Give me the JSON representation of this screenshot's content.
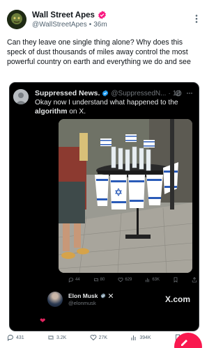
{
  "author": {
    "name": "Wall Street Apes",
    "handle": "@WallStreetApes",
    "separator": "•",
    "time": "36m"
  },
  "post": {
    "text": "Can they leave one single thing alone? Why does this speck of dust thousands of miles away control the most powerful country on earth and everything we do and see"
  },
  "quoted": {
    "name": "Suppressed News.",
    "handle": "@SuppressedN...",
    "separator": "·",
    "time": "1d",
    "text_plain_1": "Okay now I understand what happened to the ",
    "text_bold": "algorithm",
    "text_plain_2": " on X.",
    "metrics": {
      "replies": "44",
      "reposts": "80",
      "likes": "629",
      "views": "63K"
    },
    "embedded": {
      "name": "Elon Musk",
      "handle": "@elonmusk",
      "brand": "X.com"
    },
    "emoji": "❤"
  },
  "actions": {
    "replies": "431",
    "reposts": "3.2K",
    "likes": "27K",
    "views": "394K"
  },
  "colors": {
    "verified_badge": "#f91880",
    "blue_badge": "#1d9bf0",
    "fab": "#f9194f",
    "quote_bg": "#000000"
  }
}
